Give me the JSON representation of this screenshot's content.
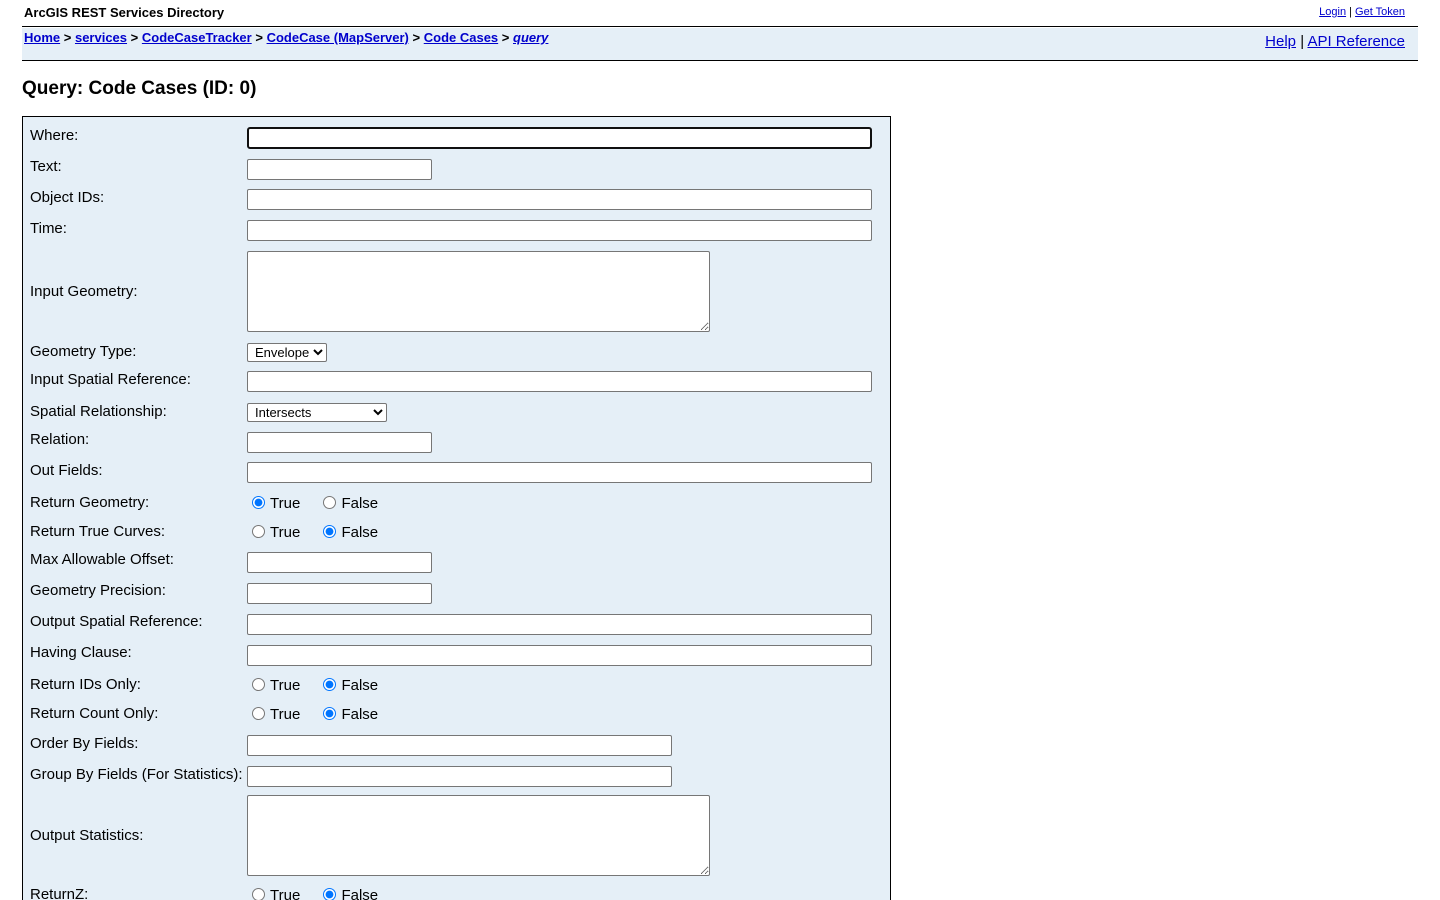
{
  "header": {
    "app_title": "ArcGIS REST Services Directory",
    "login_label": "Login",
    "get_token_label": "Get Token",
    "separator": "|"
  },
  "nav": {
    "breadcrumbs": [
      {
        "label": "Home"
      },
      {
        "label": "services"
      },
      {
        "label": "CodeCaseTracker"
      },
      {
        "label": "CodeCase (MapServer)"
      },
      {
        "label": "Code Cases"
      },
      {
        "label": "query"
      }
    ],
    "crumb_separator": ">",
    "help_label": "Help",
    "api_reference_label": "API Reference",
    "separator": "|"
  },
  "page": {
    "title": "Query: Code Cases (ID: 0)"
  },
  "form": {
    "where_label": "Where:",
    "text_label": "Text:",
    "object_ids_label": "Object IDs:",
    "time_label": "Time:",
    "input_geometry_label": "Input Geometry:",
    "geometry_type_label": "Geometry Type:",
    "geometry_type_value": "Envelope",
    "input_sr_label": "Input Spatial Reference:",
    "spatial_rel_label": "Spatial Relationship:",
    "spatial_rel_value": "Intersects",
    "relation_label": "Relation:",
    "out_fields_label": "Out Fields:",
    "return_geometry_label": "Return Geometry:",
    "return_true_curves_label": "Return True Curves:",
    "max_offset_label": "Max Allowable Offset:",
    "geometry_precision_label": "Geometry Precision:",
    "output_sr_label": "Output Spatial Reference:",
    "having_label": "Having Clause:",
    "return_ids_only_label": "Return IDs Only:",
    "return_count_only_label": "Return Count Only:",
    "order_by_label": "Order By Fields:",
    "group_by_label": "Group By Fields (For Statistics):",
    "output_statistics_label": "Output Statistics:",
    "return_z_label": "ReturnZ:",
    "true_label": "True",
    "false_label": "False"
  }
}
